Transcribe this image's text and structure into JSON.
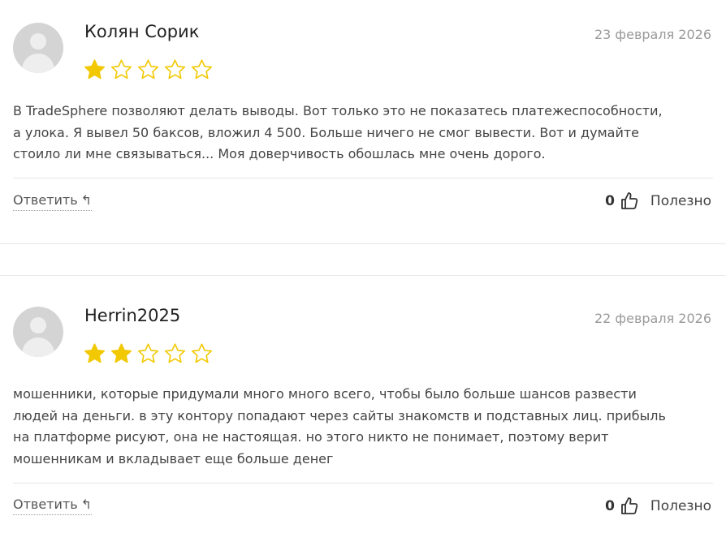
{
  "colors": {
    "star_filled": "#f2c800",
    "star_outline": "#f2c800",
    "date": "#9a9a9a"
  },
  "reviews": [
    {
      "author": "Колян Сорик",
      "date": "23 февраля 2026",
      "rating": 1,
      "max_rating": 5,
      "text_lines": [
        "В TradeSphere позволяют делать выводы. Вот только это не показатесь платежеспособности,",
        "а улока. Я вывел 50 баксов, вложил 4 500. Больше ничего не смог вывести. Вот и думайте",
        "стоило ли мне связываться... Моя доверчивость обошлась мне очень дорого."
      ],
      "reply_label": "Ответить",
      "reply_icon": "reply-arrow-icon",
      "helpful_count": "0",
      "helpful_label": "Полезно"
    },
    {
      "author": "Herrin2025",
      "date": "22 февраля 2026",
      "rating": 2,
      "max_rating": 5,
      "text_lines": [
        "мошенники, которые придумали много много всего, чтобы было больше шансов развести",
        "людей на деньги. в эту контору попадают через сайты знакомств и подставных лиц. прибыль",
        "на платформе рисуют, она не настоящая. но этого никто не понимает, поэтому верит",
        "мошенникам и вкладывает еще больше денег"
      ],
      "reply_label": "Ответить",
      "reply_icon": "reply-arrow-icon",
      "helpful_count": "0",
      "helpful_label": "Полезно"
    }
  ]
}
